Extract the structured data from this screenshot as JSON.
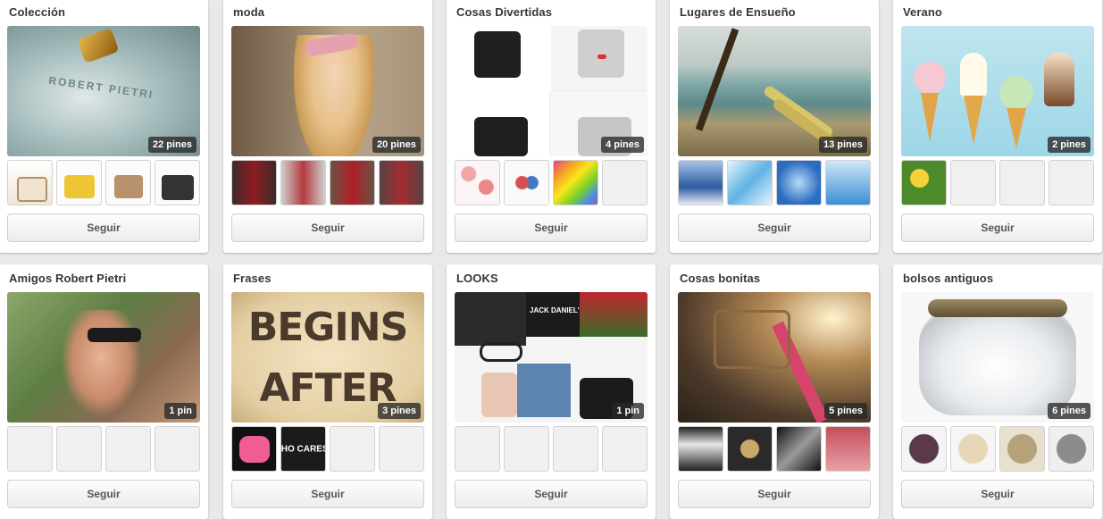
{
  "follow_label": "Seguir",
  "boards": [
    {
      "title": "Colección",
      "pins": "22 pines",
      "cover_icon": "leather-logo-image",
      "cover_text": "ROBERT PIETRI",
      "thumbs": [
        "handbag-white-thumb",
        "handbag-yellow-thumb",
        "handbag-tan-thumb",
        "handbag-black-thumb"
      ]
    },
    {
      "title": "moda",
      "pins": "20 pines",
      "cover_icon": "woman-headband-image",
      "thumbs": [
        "red-dress-thumb",
        "red-outfit-thumb",
        "red-gown-thumb",
        "red-look-thumb"
      ]
    },
    {
      "title": "Cosas Divertidas",
      "pins": "4 pines",
      "cover_icon": "mugs-image",
      "thumbs": [
        "bows-thumb",
        "sunglasses-thumb",
        "colored-pencils-thumb",
        "empty-thumb"
      ]
    },
    {
      "title": "Lugares de Ensueño",
      "pins": "13 pines",
      "cover_icon": "beach-surfboards-image",
      "thumbs": [
        "glacier-thumb",
        "ice-blue-thumb",
        "blue-cave-thumb",
        "blue-water-thumb"
      ]
    },
    {
      "title": "Verano",
      "pins": "2 pines",
      "cover_icon": "ice-cream-cones-image",
      "thumbs": [
        "flowers-thumb",
        "empty-thumb",
        "empty-thumb",
        "empty-thumb"
      ]
    },
    {
      "title": "Amigos Robert Pietri",
      "pins": "1 pin",
      "cover_icon": "woman-sunglasses-image",
      "thumbs": [
        "empty-thumb",
        "empty-thumb",
        "empty-thumb",
        "empty-thumb"
      ]
    },
    {
      "title": "Frases",
      "pins": "3 pines",
      "cover_icon": "quote-image",
      "cover_text": "BEGINS AFTER",
      "thumbs": [
        "pink-heart-thumb",
        "who-cares-thumb",
        "empty-thumb",
        "empty-thumb"
      ],
      "thumb_texts": [
        "",
        "WHO CARES?",
        "",
        ""
      ]
    },
    {
      "title": "LOOKS",
      "pins": "1 pin",
      "cover_icon": "outfit-collage-image",
      "cover_text": "JACK DANIEL'S",
      "thumbs": [
        "empty-thumb",
        "empty-thumb",
        "empty-thumb",
        "empty-thumb"
      ]
    },
    {
      "title": "Cosas bonitas",
      "pins": "5 pines",
      "cover_icon": "pink-bicycle-image",
      "thumbs": [
        "corset-thumb",
        "bracelet-thumb",
        "bw-photo-thumb",
        "red-necklace-thumb"
      ]
    },
    {
      "title": "bolsos antiguos",
      "pins": "6 pines",
      "cover_icon": "vintage-purse-image",
      "thumbs": [
        "dark-purse-thumb",
        "beaded-purse-thumb",
        "gold-purse-thumb",
        "grey-purse-thumb"
      ]
    }
  ],
  "colors": {
    "background": "#e9e9e9",
    "card": "#ffffff",
    "title": "#363636",
    "button_text": "#555555"
  }
}
